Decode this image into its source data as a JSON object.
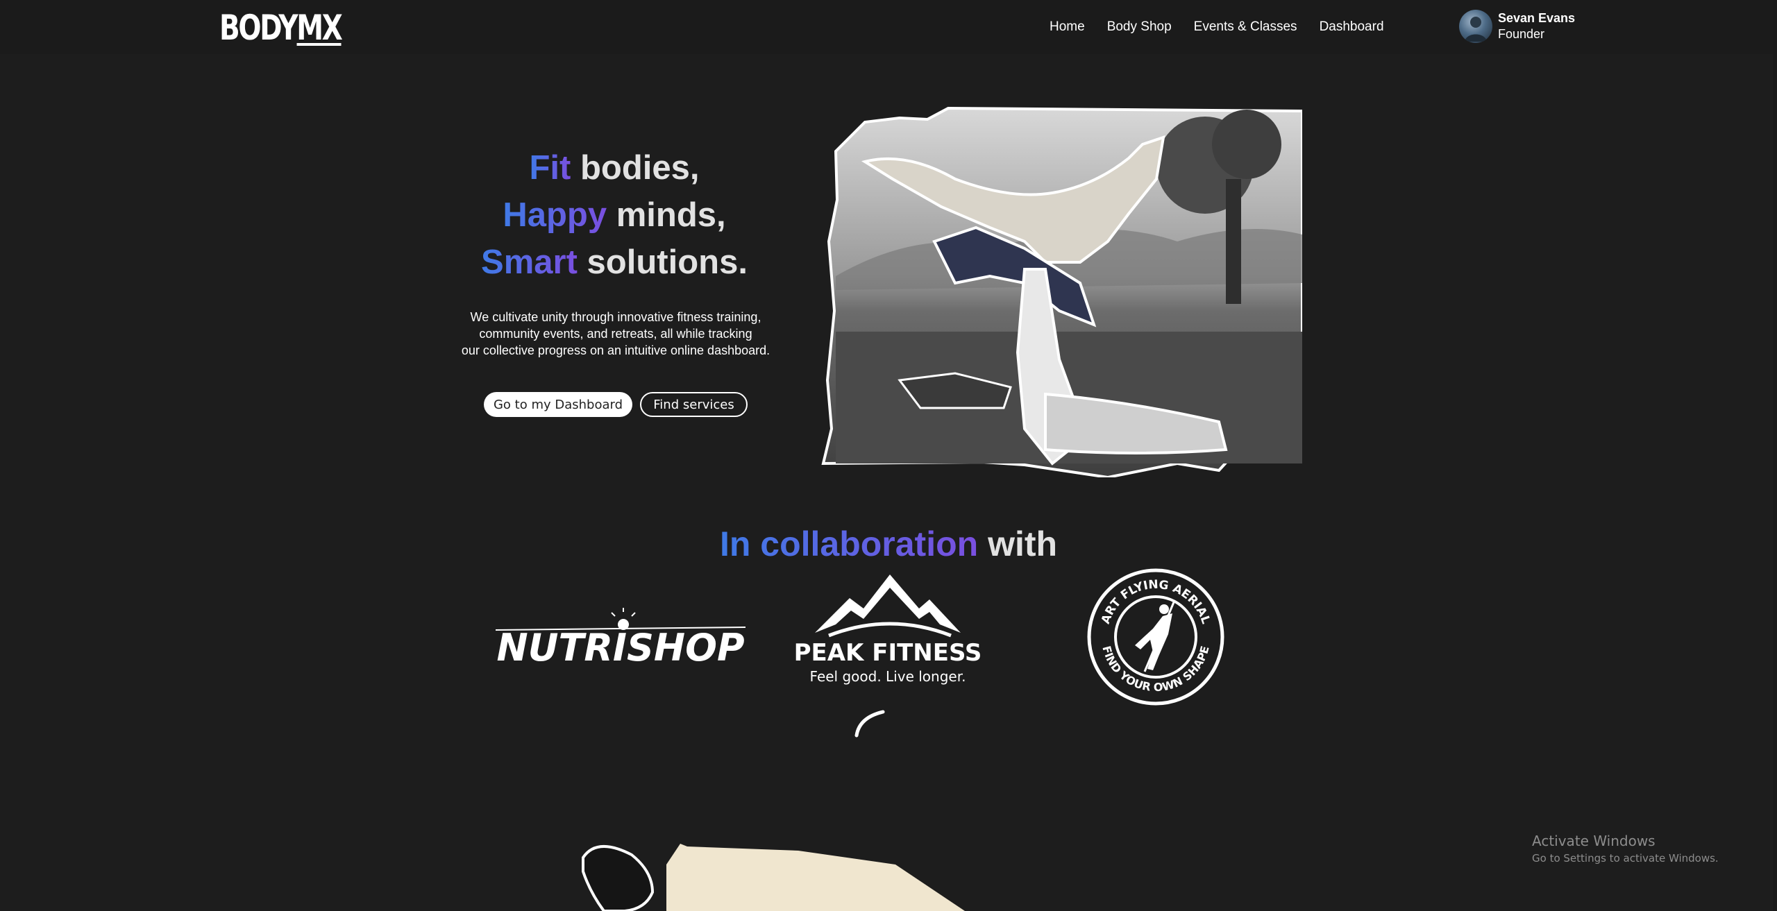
{
  "brand": {
    "logo_text_a": "BODY",
    "logo_text_b": "MX"
  },
  "nav": {
    "items": [
      "Home",
      "Body Shop",
      "Events & Classes",
      "Dashboard"
    ]
  },
  "user": {
    "name": "Sevan Evans",
    "role": "Founder"
  },
  "hero": {
    "line1_accent": "Fit",
    "line1_rest": " bodies,",
    "line2_accent": "Happy",
    "line2_rest": " minds,",
    "line3_accent": "Smart",
    "line3_rest": " solutions.",
    "text_line1": "We cultivate unity through innovative fitness training,",
    "text_line2": "community events, and retreats, all while tracking",
    "text_line3": "our collective progress on an intuitive online dashboard.",
    "primary_button": "Go to my Dashboard",
    "secondary_button": "Find services"
  },
  "collab": {
    "accent": "In collaboration",
    "rest": " with",
    "partners": {
      "nutrishop": "NUTRISHOP",
      "peak": "PEAK FITNESS",
      "peak_tagline": "Feel good. Live longer.",
      "aerial_top": "ART FLYING AERIAL",
      "aerial_bottom": "FIND YOUR OWN SHAPE"
    }
  },
  "system": {
    "activate_title": "Activate Windows",
    "activate_sub": "Go to Settings to activate Windows."
  },
  "colors": {
    "background": "#1d1d1d",
    "gradient_start": "#3f7ae6",
    "gradient_end": "#7a4fe0",
    "text": "#e2e2e2"
  }
}
